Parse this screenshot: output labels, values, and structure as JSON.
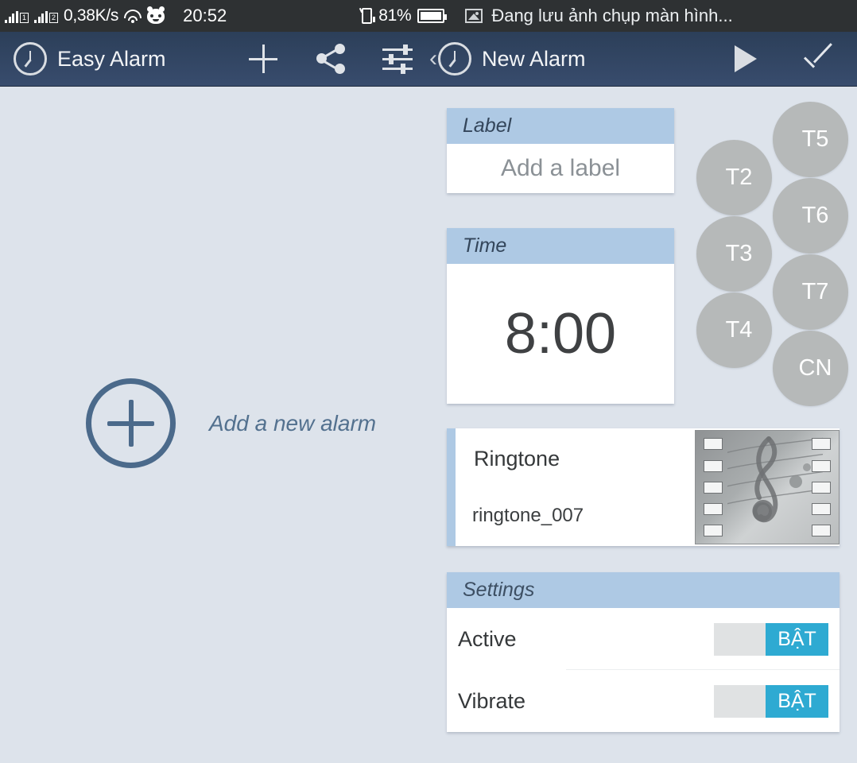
{
  "status_bar": {
    "network_speed": "0,38K/s",
    "sim1_badge": "1",
    "sim2_badge": "2",
    "clock": "20:52",
    "battery_percent": "81%",
    "notification_text": "Đang lưu ảnh chụp màn hình...",
    "icons": [
      "signal-bars-sim1-icon",
      "signal-bars-sim2-icon",
      "wifi-icon",
      "bug-face-icon",
      "phone-vibrate-icon",
      "battery-icon",
      "image-icon"
    ]
  },
  "app_bar": {
    "left_title": "Easy Alarm",
    "right_title": "New Alarm",
    "back_chevron": "‹",
    "actions": [
      "add-icon",
      "share-icon",
      "tune-icon",
      "play-icon",
      "confirm-check-icon"
    ]
  },
  "left_pane": {
    "add_new_alarm_label": "Add a new alarm"
  },
  "detail": {
    "label_card": {
      "header": "Label",
      "placeholder": "Add a label",
      "value": ""
    },
    "time_card": {
      "header": "Time",
      "value": "8:00"
    },
    "days": [
      {
        "id": "t2",
        "label": "T2",
        "active": false
      },
      {
        "id": "t3",
        "label": "T3",
        "active": false
      },
      {
        "id": "t4",
        "label": "T4",
        "active": false
      },
      {
        "id": "t5",
        "label": "T5",
        "active": false
      },
      {
        "id": "t6",
        "label": "T6",
        "active": false
      },
      {
        "id": "t7",
        "label": "T7",
        "active": false
      },
      {
        "id": "cn",
        "label": "CN",
        "active": false
      }
    ],
    "ringtone_card": {
      "title": "Ringtone",
      "name": "ringtone_007",
      "thumbnail": "music-film-strip-thumbnail"
    },
    "settings_card": {
      "header": "Settings",
      "rows": [
        {
          "label": "Active",
          "toggle_text": "BẬT",
          "state": "on"
        },
        {
          "label": "Vibrate",
          "toggle_text": "BẬT",
          "state": "on"
        }
      ]
    }
  },
  "colors": {
    "status_bar_bg": "#2e3133",
    "app_bar_top": "#2c3f59",
    "app_bar_bottom": "#384c6d",
    "page_bg": "#dde3eb",
    "card_header_blue": "#aec9e4",
    "toggle_on_blue": "#2eaad2",
    "day_inactive_gray": "#b6b9b9",
    "accent_slate": "#4b6a8b"
  }
}
